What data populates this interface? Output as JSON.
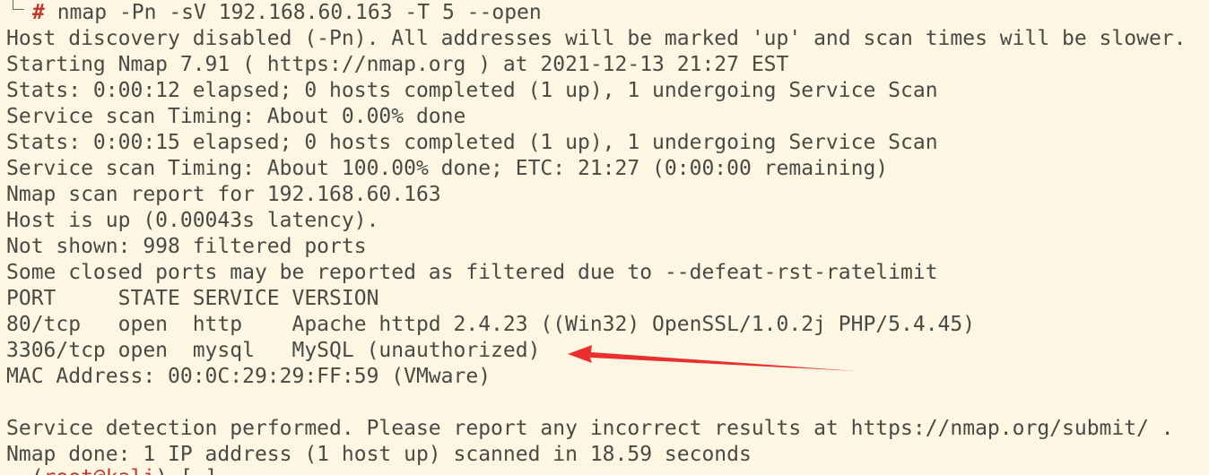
{
  "prompt": {
    "symbol": "#",
    "command": " nmap -Pn -sV 192.168.60.163 -T 5 --open"
  },
  "output_lines": [
    "Host discovery disabled (-Pn). All addresses will be marked 'up' and scan times will be slower.",
    "Starting Nmap 7.91 ( https://nmap.org ) at 2021-12-13 21:27 EST",
    "Stats: 0:00:12 elapsed; 0 hosts completed (1 up), 1 undergoing Service Scan",
    "Service scan Timing: About 0.00% done",
    "Stats: 0:00:15 elapsed; 0 hosts completed (1 up), 1 undergoing Service Scan",
    "Service scan Timing: About 100.00% done; ETC: 21:27 (0:00:00 remaining)",
    "Nmap scan report for 192.168.60.163",
    "Host is up (0.00043s latency).",
    "Not shown: 998 filtered ports",
    "Some closed ports may be reported as filtered due to --defeat-rst-ratelimit",
    "PORT     STATE SERVICE VERSION",
    "80/tcp   open  http    Apache httpd 2.4.23 ((Win32) OpenSSL/1.0.2j PHP/5.4.45)",
    "3306/tcp open  mysql   MySQL (unauthorized)",
    "MAC Address: 00:0C:29:29:FF:59 (VMware)",
    "",
    "Service detection performed. Please report any incorrect results at https://nmap.org/submit/ .",
    "Nmap done: 1 IP address (1 host up) scanned in 18.59 seconds"
  ],
  "next_prompt": {
    "part1": "  (",
    "user_host": "root@kali",
    "part2": ")-[~]"
  },
  "colors": {
    "background": "#fdf6e3",
    "text": "#4a4a44",
    "prompt_hash": "#c0392b",
    "annotation_arrow": "#e83030"
  },
  "icons": {
    "annotation": "red-arrow-icon"
  }
}
